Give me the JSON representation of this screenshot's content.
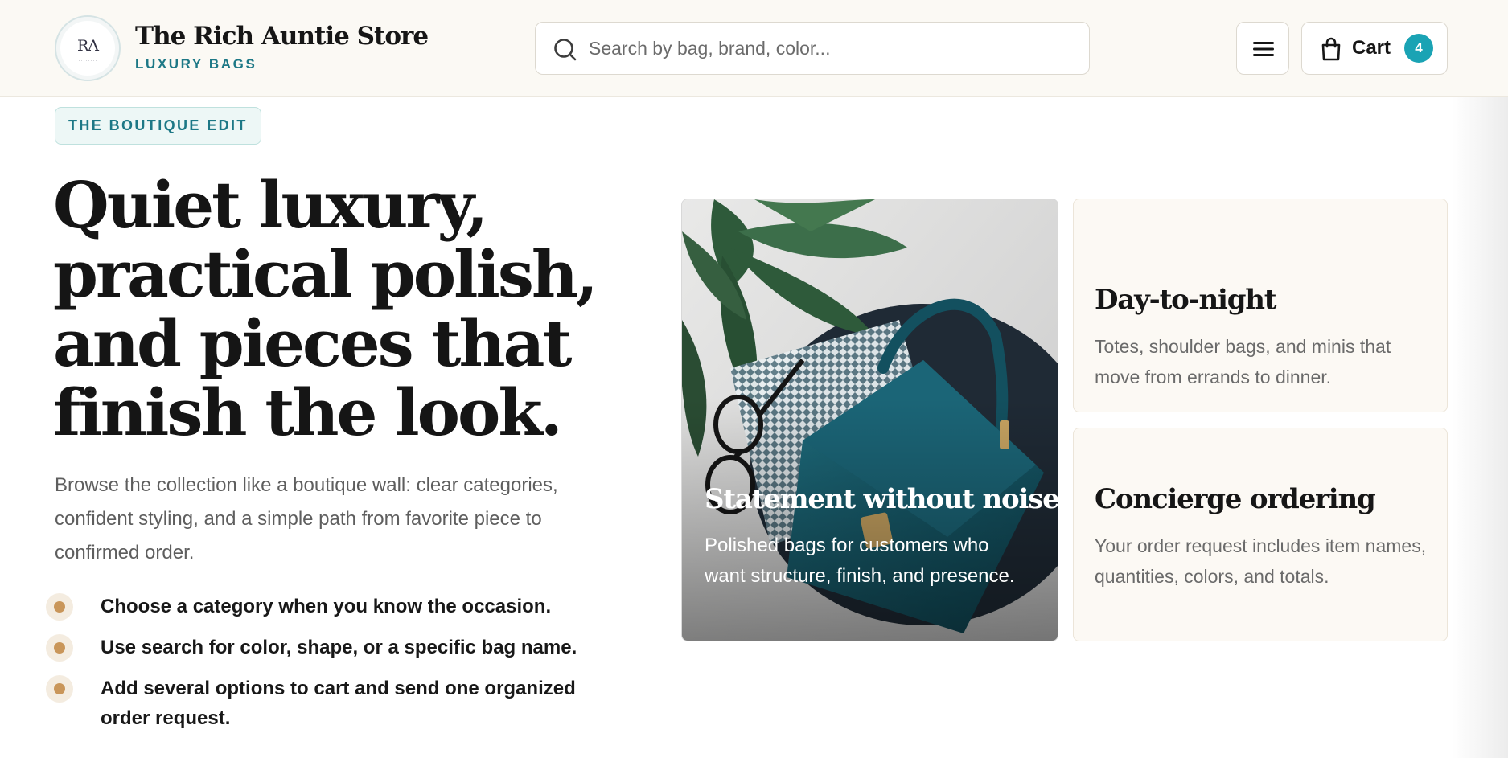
{
  "header": {
    "logo_monogram": "RA",
    "brand_name": "The Rich Auntie Store",
    "brand_tagline": "LUXURY BAGS",
    "search_placeholder": "Search by bag, brand, color...",
    "menu_icon": "hamburger-menu-icon",
    "cart_icon": "shopping-bag-icon",
    "cart_label": "Cart",
    "cart_count": "4"
  },
  "hero": {
    "eyebrow": "THE BOUTIQUE EDIT",
    "title": "Quiet luxury, practical polish, and pieces that finish the look.",
    "description": "Browse the collection like a boutique wall: clear categories, confident styling, and a simple path from favorite piece to confirmed order.",
    "bullets": [
      "Choose a category when you know the occasion.",
      "Use search for color, shape, or a specific bag name.",
      "Add several options to cart and send one organized order request."
    ]
  },
  "features": {
    "photo_card": {
      "title": "Statement without noise",
      "description": "Polished bags for customers who want structure, finish, and presence."
    },
    "cards": [
      {
        "title": "Day-to-night",
        "description": "Totes, shoulder bags, and minis that move from errands to dinner."
      },
      {
        "title": "Concierge ordering",
        "description": "Your order request includes item names, quantities, colors, and totals."
      }
    ]
  },
  "colors": {
    "accent_teal": "#1d7886",
    "cart_badge": "#1aa3b4",
    "bullet_gold": "#c9965a",
    "header_bg": "#fbf9f4",
    "card_bg": "#fcf9f4"
  }
}
